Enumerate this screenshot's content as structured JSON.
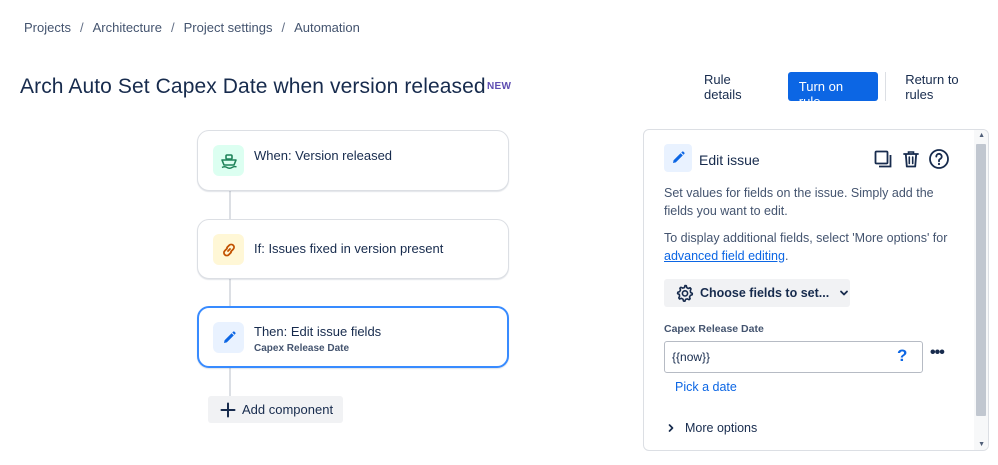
{
  "breadcrumb": {
    "items": [
      "Projects",
      "Architecture",
      "Project settings",
      "Automation"
    ],
    "separator": "/"
  },
  "header": {
    "title": "Arch Auto Set Capex Date when version released",
    "badge": "NEW",
    "rule_details_label": "Rule details",
    "turn_on_label": "Turn on rule",
    "return_label": "Return to rules"
  },
  "flow": {
    "trigger": {
      "label": "When: Version released",
      "icon": "ship-icon"
    },
    "condition": {
      "label": "If: Issues fixed in version present",
      "icon": "link-icon"
    },
    "action": {
      "label": "Then: Edit issue fields",
      "sublabel": "Capex Release Date",
      "icon": "pencil-icon"
    },
    "add_component_label": "Add component"
  },
  "panel": {
    "title": "Edit issue",
    "description": "Set values for fields on the issue. Simply add the fields you want to edit.",
    "more_text_prefix": "To display additional fields, select 'More options' for",
    "more_text_link": "advanced field editing",
    "more_text_suffix": ".",
    "choose_fields_label": "Choose fields to set...",
    "field": {
      "label": "Capex Release Date",
      "value": "{{now}}",
      "help": "?",
      "more": "•••"
    },
    "pick_date_label": "Pick a date",
    "more_options_label": "More options"
  },
  "colors": {
    "primary": "#0c66e4",
    "trigger_icon_bg": "#dcfff1",
    "condition_icon_bg": "#fff7d6",
    "action_icon_bg": "#e9f2ff",
    "selected_border": "#388bff"
  }
}
